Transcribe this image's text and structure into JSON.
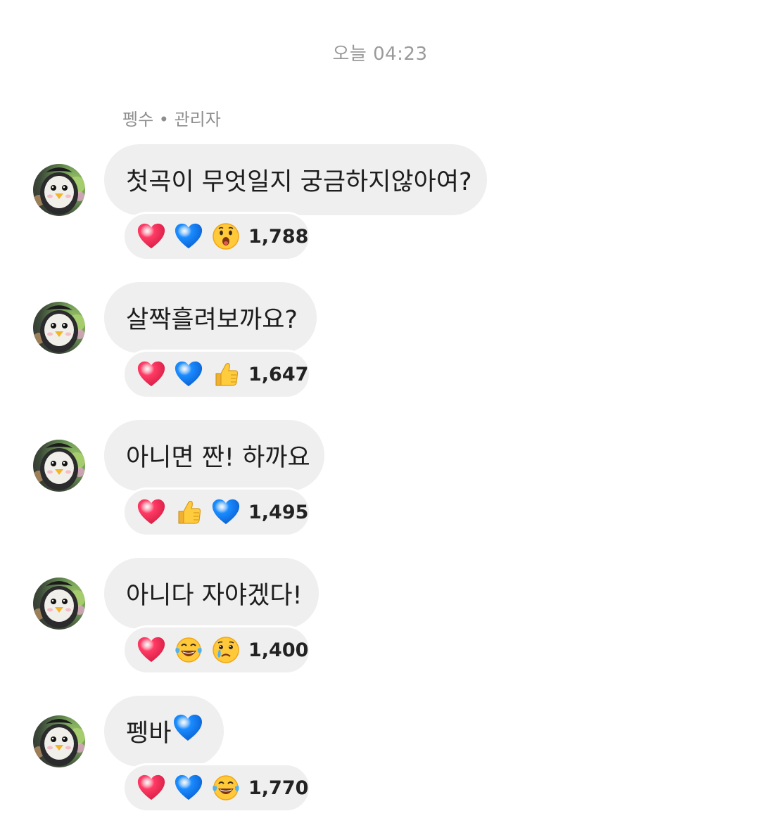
{
  "timestamp": "오늘 04:23",
  "sender_label": "펭수 • 관리자",
  "colors": {
    "bubble_bg": "#efefef",
    "timestamp_text": "#9a9a9a",
    "heart_red": "#ff3b64",
    "heart_blue": "#1a8cff"
  },
  "messages": [
    {
      "text": "첫곡이 무엇일지 궁금하지않아여?",
      "reactions": [
        "red-heart-icon",
        "blue-heart-icon",
        "surprised-face-icon"
      ],
      "count": "1,788"
    },
    {
      "text": "살짝흘려보까요?",
      "reactions": [
        "red-heart-icon",
        "blue-heart-icon",
        "thumbs-up-icon"
      ],
      "count": "1,647"
    },
    {
      "text": "아니면 짠! 하까요",
      "reactions": [
        "red-heart-icon",
        "thumbs-up-icon",
        "blue-heart-icon"
      ],
      "count": "1,495"
    },
    {
      "text": "아니다 자야겠다!",
      "reactions": [
        "red-heart-icon",
        "laughing-tears-icon",
        "crying-face-icon"
      ],
      "count": "1,400"
    },
    {
      "text": "펭바",
      "inline_icon": "blue-heart-icon",
      "reactions": [
        "red-heart-icon",
        "blue-heart-icon",
        "laughing-tears-icon"
      ],
      "count": "1,770"
    }
  ]
}
